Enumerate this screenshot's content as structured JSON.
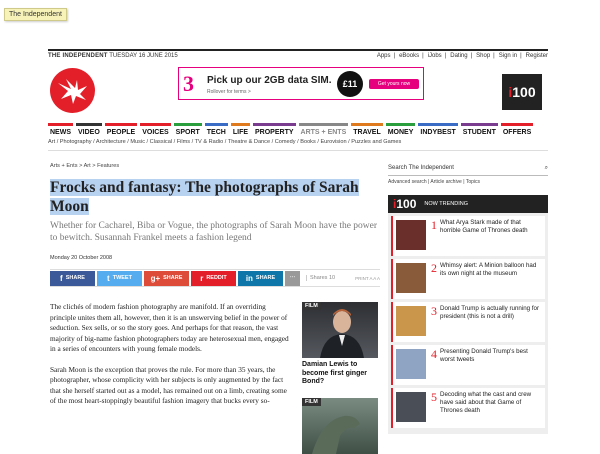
{
  "tooltip": "The Independent",
  "masthead": {
    "brand": "THE INDEPENDENT",
    "date": "TUESDAY 16 JUNE 2015",
    "links": [
      "Apps",
      "eBooks",
      "iJobs",
      "Dating",
      "Shop",
      "Sign in",
      "Register"
    ]
  },
  "ad": {
    "headline": "Pick up our 2GB data SIM.",
    "small": "Rollover for terms >",
    "price": "£11",
    "cta": "Get yours now",
    "logo": "3"
  },
  "i100": {
    "prefix": "i",
    "suffix": "100"
  },
  "nav": [
    {
      "label": "NEWS",
      "color": "#e3202a"
    },
    {
      "label": "VIDEO",
      "color": "#333"
    },
    {
      "label": "PEOPLE",
      "color": "#e3202a"
    },
    {
      "label": "VOICES",
      "color": "#e3202a"
    },
    {
      "label": "SPORT",
      "color": "#2a9d3c"
    },
    {
      "label": "TECH",
      "color": "#3a6cc6"
    },
    {
      "label": "LIFE",
      "color": "#e07a1e"
    },
    {
      "label": "PROPERTY",
      "color": "#7a3c8f"
    },
    {
      "label": "ARTS + ENTS",
      "color": "#888"
    },
    {
      "label": "TRAVEL",
      "color": "#e07a1e"
    },
    {
      "label": "MONEY",
      "color": "#2a9d3c"
    },
    {
      "label": "INDYBEST",
      "color": "#3a6cc6"
    },
    {
      "label": "STUDENT",
      "color": "#7a3c8f"
    },
    {
      "label": "OFFERS",
      "color": "#e3202a"
    }
  ],
  "subnav": "Art / Photography / Architecture / Music / Classical / Films / TV & Radio / Theatre & Dance / Comedy / Books / Eurovision / Puzzles and Games",
  "breadcrumb": "Arts + Ents  >  Art  >  Features",
  "article": {
    "title": "Frocks and fantasy: The photographs of Sarah Moon",
    "standfirst": "Whether for Cacharel, Biba or Vogue, the photographs of Sarah Moon have the power to bewitch. Susannah Frankel meets a fashion legend",
    "date": "Monday 20 October 2008",
    "paragraphs": [
      "The clichés of modern fashion photography are manifold. If an overriding principle unites them all, however, then it is an unswerving belief in the power of seduction. Sex sells, or so the story goes. And perhaps for that reason, the vast majority of big-name fashion photographers today are heterosexual men, engaged in a series of encounters with young female models.",
      "Sarah Moon is the exception that proves the rule. For more than 35 years, the photographer, whose complicity with her subjects is only augmented by the fact that she herself started out as a model, has remained out on a limb, creating some of the most heart-stoppingly beautiful fashion imagery that bucks every so-"
    ]
  },
  "share": {
    "buttons": [
      {
        "label": "SHARE",
        "icon": "f",
        "color": "#3b5998"
      },
      {
        "label": "TWEET",
        "icon": "t",
        "color": "#55acee"
      },
      {
        "label": "SHARE",
        "icon": "g+",
        "color": "#dd4b39"
      },
      {
        "label": "REDDIT",
        "icon": "r",
        "color": "#e3202a"
      },
      {
        "label": "SHARE",
        "icon": "in",
        "color": "#0e76a8"
      }
    ],
    "count": "Shares 10",
    "print": "PRINT  A A A"
  },
  "related": [
    {
      "tag": "FILM",
      "caption": "Damian Lewis to become first ginger Bond?"
    },
    {
      "tag": "FILM",
      "caption": ""
    }
  ],
  "sidebar": {
    "search_placeholder": "Search The Independent",
    "search_links": "Advanced search  |  Article archive  |  Topics",
    "trending_label": "NOW TRENDING",
    "items": [
      {
        "num": "1",
        "text": "What Arya Stark made of that horrible Game of Thrones death",
        "thumb": "#6a2f2a"
      },
      {
        "num": "2",
        "text": "Whimsy alert: A Minion balloon had its own night at the museum",
        "thumb": "#8a5b3a"
      },
      {
        "num": "3",
        "text": "Donald Trump is actually running for president (this is not a drill)",
        "thumb": "#c9964c"
      },
      {
        "num": "4",
        "text": "Presenting Donald Trump's best worst tweets",
        "thumb": "#8fa3c2"
      },
      {
        "num": "5",
        "text": "Decoding what the cast and crew have said about that Game of Thrones death",
        "thumb": "#4a4f57"
      }
    ]
  }
}
